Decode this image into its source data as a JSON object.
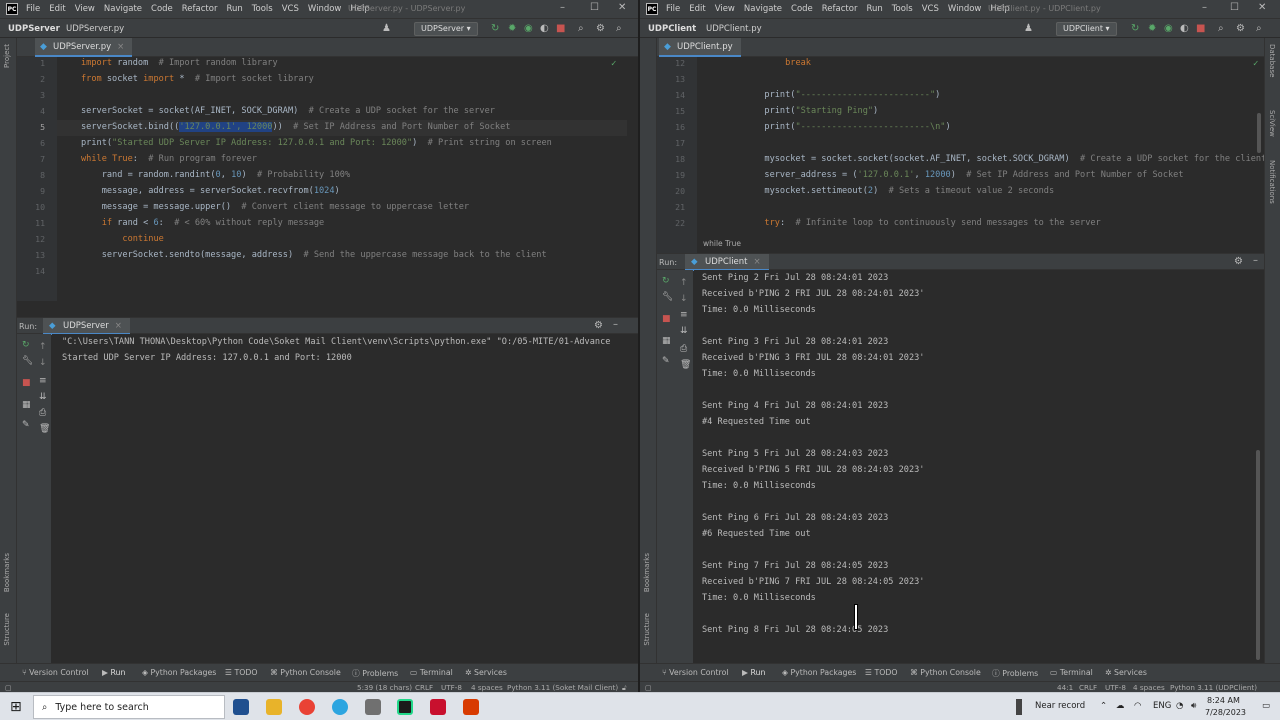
{
  "menu": [
    "File",
    "Edit",
    "View",
    "Navigate",
    "Code",
    "Refactor",
    "Run",
    "Tools",
    "VCS",
    "Window",
    "Help"
  ],
  "left": {
    "logo": "PC",
    "window_title": "UDPServer.py - UDPServer.py",
    "project_name": "UDPServer",
    "breadcrumb": "UDPServer.py",
    "run_config": "UDPServer",
    "tab_label": "UDPServer.py",
    "code_lines": [
      {
        "n": "1"
      },
      {
        "n": "2"
      },
      {
        "n": "3"
      },
      {
        "n": "4"
      },
      {
        "n": "5"
      },
      {
        "n": "6"
      },
      {
        "n": "7"
      },
      {
        "n": "8"
      },
      {
        "n": "9"
      },
      {
        "n": "10"
      },
      {
        "n": "11"
      },
      {
        "n": "12"
      },
      {
        "n": "13"
      },
      {
        "n": "14"
      }
    ],
    "run_label": "Run:",
    "run_tab": "UDPServer",
    "console": [
      "\"C:\\Users\\TANN THONA\\Desktop\\Python Code\\Soket Mail Client\\venv\\Scripts\\python.exe\" \"O:/05-MITE/01-Advance",
      "Started UDP Server IP Address: 127.0.0.1 and Port: 12000"
    ],
    "status": {
      "pos": "5:39 (18 chars)",
      "eol": "CRLF",
      "enc": "UTF-8",
      "indent": "4 spaces",
      "interp": "Python 3.11 (Soket Mail Client)"
    }
  },
  "right": {
    "logo": "PC",
    "window_title": "UDPClient.py - UDPClient.py",
    "project_name": "UDPClient",
    "breadcrumb": "UDPClient.py",
    "run_config": "UDPClient",
    "tab_label": "UDPClient.py",
    "line_numbers": [
      "12",
      "13",
      "14",
      "15",
      "16",
      "17",
      "18",
      "19",
      "20",
      "21",
      "22"
    ],
    "hint": "while True",
    "run_label": "Run:",
    "run_tab": "UDPClient",
    "console": [
      "Sent Ping 2 Fri Jul 28 08:24:01 2023",
      "Received b'PING 2 FRI JUL 28 08:24:01 2023'",
      "Time: 0.0 Milliseconds",
      "",
      "Sent Ping 3 Fri Jul 28 08:24:01 2023",
      "Received b'PING 3 FRI JUL 28 08:24:01 2023'",
      "Time: 0.0 Milliseconds",
      "",
      "Sent Ping 4 Fri Jul 28 08:24:01 2023",
      "#4 Requested Time out",
      "",
      "Sent Ping 5 Fri Jul 28 08:24:03 2023",
      "Received b'PING 5 FRI JUL 28 08:24:03 2023'",
      "Time: 0.0 Milliseconds",
      "",
      "Sent Ping 6 Fri Jul 28 08:24:03 2023",
      "#6 Requested Time out",
      "",
      "Sent Ping 7 Fri Jul 28 08:24:05 2023",
      "Received b'PING 7 FRI JUL 28 08:24:05 2023'",
      "Time: 0.0 Milliseconds",
      "",
      "Sent Ping 8 Fri Jul 28 08:24:05 2023"
    ],
    "status": {
      "pos": "44:1",
      "eol": "CRLF",
      "enc": "UTF-8",
      "indent": "4 spaces",
      "interp": "Python 3.11 (UDPClient)"
    }
  },
  "side_labels": {
    "project": "Project",
    "bookmarks": "Bookmarks",
    "structure": "Structure",
    "database": "Database",
    "sciview": "SciView",
    "notifications": "Notifications"
  },
  "toolwindows": [
    "Version Control",
    "Run",
    "Python Packages",
    "TODO",
    "Python Console",
    "Problems",
    "Terminal",
    "Services"
  ],
  "taskbar": {
    "search_placeholder": "Type here to search",
    "near_record": "Near record",
    "lang": "ENG",
    "time": "8:24 AM",
    "date": "7/28/2023"
  },
  "colors": {
    "keyword": "#cc7832",
    "string": "#6a8759",
    "number": "#6897bb",
    "comment": "#808080",
    "accent": "#4a88c7"
  }
}
